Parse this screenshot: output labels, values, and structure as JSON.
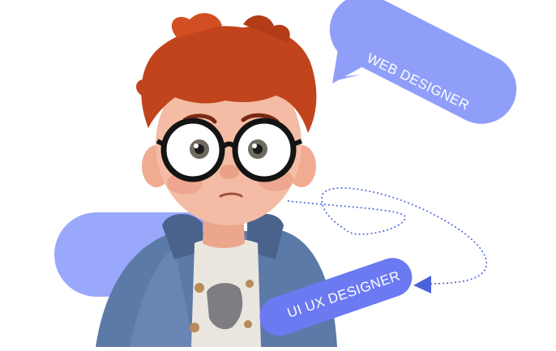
{
  "badges": {
    "web_designer": "WEB DESIGNER",
    "ui_ux_designer": "UI UX DESIGNER"
  },
  "colors": {
    "bubble_blue": "#8f9ef9",
    "tag_blue": "#6b7af1",
    "dotted_line": "#4b63d8",
    "hair": "#c1441d",
    "jacket": "#5c7aa7",
    "skin": "#f2b79f"
  },
  "illustration": "cartoon-boy-with-glasses"
}
